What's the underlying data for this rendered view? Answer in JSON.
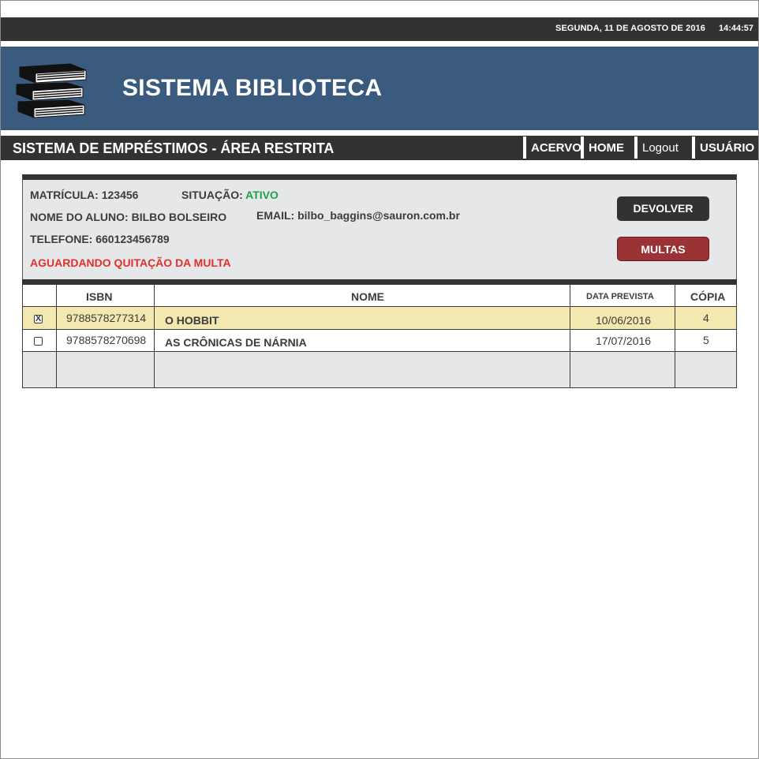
{
  "header": {
    "date": "SEGUNDA, 11 DE AGOSTO DE 2016",
    "time": "14:44:57"
  },
  "banner": {
    "title": "SISTEMA BIBLIOTECA",
    "logo_icon": "books-stack-icon",
    "color": "#3a5a7e"
  },
  "subheader": {
    "title": "SISTEMA DE EMPRÉSTIMOS - ÁREA RESTRITA",
    "nav": [
      {
        "label": "ACERVO"
      },
      {
        "label": "HOME"
      },
      {
        "label": "Logout"
      },
      {
        "label": "USUÁRIO"
      }
    ]
  },
  "student": {
    "matricula_label": "MATRÍCULA:",
    "matricula": "123456",
    "situacao_label": "SITUAÇÃO:",
    "situacao": "ATIVO",
    "nome_label": "NOME DO ALUNO:",
    "nome": "BILBO BOLSEIRO",
    "email_label": "EMAIL:",
    "email": "bilbo_baggins@sauron.com.br",
    "telefone_label": "TELEFONE:",
    "telefone": "660123456789",
    "alerta": "AGUARDANDO QUITAÇÃO DA MULTA"
  },
  "actions": {
    "devolver": "DEVOLVER",
    "multas": "MULTAS"
  },
  "table": {
    "columns": [
      "ISBN",
      "NOME",
      "DATA PREVISTA",
      "CÓPIA"
    ],
    "rows": [
      {
        "checked": true,
        "check_mark": "X",
        "isbn": "9788578277314",
        "nome": "O HOBBIT",
        "data": "10/06/2016",
        "copia": "4"
      },
      {
        "checked": false,
        "check_mark": "",
        "isbn": "9788578270698",
        "nome": "AS CRÔNICAS DE NÁRNIA",
        "data": "17/07/2016",
        "copia": "5"
      }
    ]
  },
  "colors": {
    "dark": "#333132",
    "active": "#1ba34a",
    "alert": "#e0312d",
    "selected_row": "#f2e8b0",
    "multas_button": "#9b3235"
  }
}
